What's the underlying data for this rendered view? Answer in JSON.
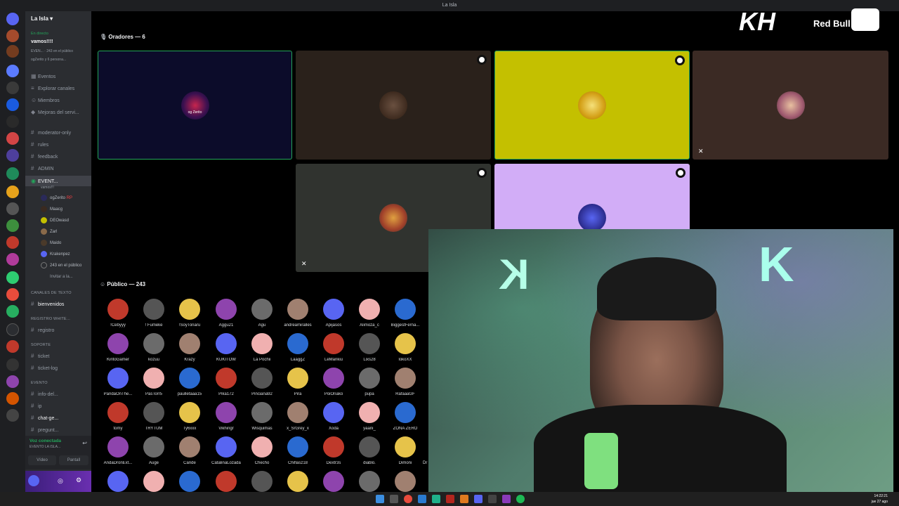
{
  "window_title": "La Isla",
  "server": {
    "name": "La Isla"
  },
  "live": {
    "label": "En directo",
    "event_title": "vamos!!!!",
    "event_line": "EVEN... · 243 en el público",
    "event_users": "ogZerito y 6 persona..."
  },
  "nav": [
    "Eventos",
    "Explorar canales",
    "Miembros",
    "Mejoras del servi..."
  ],
  "channels_top": [
    "moderator-only",
    "rules",
    "feedback",
    "ADMIN"
  ],
  "stage_channel": {
    "name": "EVENT...",
    "sub": "vamos!!!"
  },
  "voice_users": [
    {
      "name": "ogZerito",
      "tag": "RP"
    },
    {
      "name": "Maacg",
      "tag": ""
    },
    {
      "name": "DEOwasd",
      "tag": ""
    },
    {
      "name": "Zarl",
      "tag": ""
    },
    {
      "name": "Maido",
      "tag": ""
    },
    {
      "name": "Krakenpez",
      "tag": ""
    },
    {
      "name": "243 en el público",
      "tag": ""
    },
    {
      "name": "Invitar a la...",
      "tag": ""
    }
  ],
  "categories": {
    "text": "Canales de texto",
    "registro": "REGISTRO WHITE...",
    "soporte": "SOPORTE",
    "evento": "EVENTO"
  },
  "text_channels": [
    "bienvenidos"
  ],
  "registro_channels": [
    "registro"
  ],
  "soporte_channels": [
    "ticket",
    "ticket-log"
  ],
  "evento_channels": [
    "info-del...",
    "ip",
    "chat-ge...",
    "pregunt..."
  ],
  "voice_status": {
    "label": "Voz conectada",
    "sub": "EVENTO LA ISLA..."
  },
  "voice_buttons": [
    "Vídeo",
    "Pantall"
  ],
  "stage": {
    "speakers_title": "Oradores — 6",
    "audience_title": "Público — 243",
    "speaker_name_1": "og Zerito"
  },
  "audience": [
    [
      "!Cebyyy",
      "! Fumeke",
      "!SoyTonaru",
      "Aggu21",
      "Agu",
      "andreamiralles",
      "Apijasos",
      "Alimoza_c",
      "BiggestFerna..."
    ],
    [
      "KiritoGamer",
      "kozuu",
      "Krazy",
      "KUKITOW",
      "La Pochii",
      "LaaggZ",
      "LeMankiu",
      "Lixs28",
      "lokoXX"
    ],
    [
      "PandaOnThe...",
      "PasTorr5",
      "paulletaaa15",
      "Pika172",
      "Pinciana92",
      "Pira",
      "PoiOnako",
      "pupa",
      "RafaaaGF"
    ],
    [
      "tomy",
      "TRYTUM",
      "Ty6xxx",
      "Vikhingr",
      "Wisquimas",
      "x_SrGrey_x",
      "Xoda",
      "yaani_",
      "ZONA ZERO"
    ],
    [
      "AndaDronExt...",
      "Auge",
      "Cande",
      "CatalinaLozada",
      "Checho",
      "Chiflasz18",
      "Dextr3s",
      "diablo.",
      "Dimoni"
    ],
    [
      "",
      "",
      "",
      "",
      "",
      "",
      "",
      "",
      ""
    ]
  ],
  "audience_overflow": "Dr",
  "overlay_brand": "Red Bull",
  "clock": {
    "time": "14:22:21",
    "date": "jue 27 ago"
  },
  "colors": {
    "accent": "#5865f2",
    "speaker_active_border": "#23a55a",
    "yellow_tile": "#c4c000",
    "purple_tile": "#d2adf7",
    "brown_tile": "#3b2a20"
  }
}
